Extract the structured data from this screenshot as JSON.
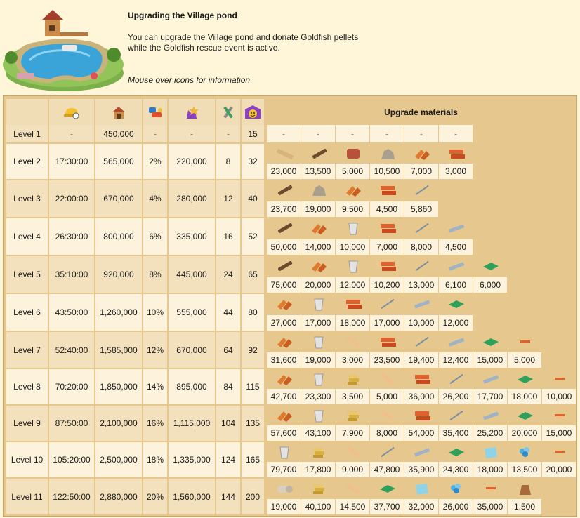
{
  "header": {
    "title": "Upgrading the Village pond",
    "description_line1": "You can upgrade the Village pond and donate Goldfish pellets",
    "description_line2": "while the Goldfish rescue event is active.",
    "hint": "Mouse over icons for information"
  },
  "table": {
    "materials_header": "Upgrade materials",
    "column_icons": [
      "hard-hat-icon",
      "house-icon",
      "percent-icon",
      "star-icon",
      "tools-icon",
      "happiness-icon"
    ],
    "rows": [
      {
        "level": "Level 1",
        "time": "-",
        "coins": "450,000",
        "pct": "-",
        "xp": "-",
        "tools": "-",
        "happy": "15",
        "materials": [
          {
            "icon": "dash",
            "value": "-"
          },
          {
            "icon": "dash",
            "value": "-"
          },
          {
            "icon": "dash",
            "value": "-"
          },
          {
            "icon": "dash",
            "value": "-"
          },
          {
            "icon": "dash",
            "value": "-"
          },
          {
            "icon": "dash",
            "value": "-"
          }
        ]
      },
      {
        "level": "Level 2",
        "time": "17:30:00",
        "coins": "565,000",
        "pct": "2%",
        "xp": "220,000",
        "tools": "8",
        "happy": "32",
        "materials": [
          {
            "icon": "plank",
            "value": "23,000"
          },
          {
            "icon": "log",
            "value": "13,500"
          },
          {
            "icon": "clay",
            "value": "5,000"
          },
          {
            "icon": "stone",
            "value": "10,500"
          },
          {
            "icon": "roof-tile",
            "value": "7,000"
          },
          {
            "icon": "brick",
            "value": "3,000"
          }
        ]
      },
      {
        "level": "Level 3",
        "time": "22:00:00",
        "coins": "670,000",
        "pct": "4%",
        "xp": "280,000",
        "tools": "12",
        "happy": "40",
        "materials": [
          {
            "icon": "log",
            "value": "23,700"
          },
          {
            "icon": "stone",
            "value": "19,000"
          },
          {
            "icon": "roof-tile",
            "value": "9,500"
          },
          {
            "icon": "brick",
            "value": "4,500"
          },
          {
            "icon": "nail",
            "value": "5,860"
          }
        ]
      },
      {
        "level": "Level 4",
        "time": "26:30:00",
        "coins": "800,000",
        "pct": "6%",
        "xp": "335,000",
        "tools": "16",
        "happy": "52",
        "materials": [
          {
            "icon": "log",
            "value": "50,000"
          },
          {
            "icon": "roof-tile",
            "value": "14,000"
          },
          {
            "icon": "mortar",
            "value": "10,000"
          },
          {
            "icon": "brick",
            "value": "7,000"
          },
          {
            "icon": "nail",
            "value": "8,000"
          },
          {
            "icon": "steel-beam",
            "value": "4,500"
          }
        ]
      },
      {
        "level": "Level 5",
        "time": "35:10:00",
        "coins": "920,000",
        "pct": "8%",
        "xp": "445,000",
        "tools": "24",
        "happy": "65",
        "materials": [
          {
            "icon": "log",
            "value": "75,000"
          },
          {
            "icon": "roof-tile",
            "value": "20,000"
          },
          {
            "icon": "mortar",
            "value": "12,000"
          },
          {
            "icon": "brick",
            "value": "10,200"
          },
          {
            "icon": "nail",
            "value": "13,000"
          },
          {
            "icon": "steel-beam",
            "value": "6,100"
          },
          {
            "icon": "glass",
            "value": "6,000"
          }
        ]
      },
      {
        "level": "Level 6",
        "time": "43:50:00",
        "coins": "1,260,000",
        "pct": "10%",
        "xp": "555,000",
        "tools": "44",
        "happy": "80",
        "materials": [
          {
            "icon": "roof-tile",
            "value": "27,000"
          },
          {
            "icon": "mortar",
            "value": "17,000"
          },
          {
            "icon": "brick",
            "value": "18,000"
          },
          {
            "icon": "nail",
            "value": "17,000"
          },
          {
            "icon": "steel-beam",
            "value": "10,000"
          },
          {
            "icon": "glass",
            "value": "12,000"
          }
        ]
      },
      {
        "level": "Level 7",
        "time": "52:40:00",
        "coins": "1,585,000",
        "pct": "12%",
        "xp": "670,000",
        "tools": "64",
        "happy": "92",
        "materials": [
          {
            "icon": "roof-tile",
            "value": "31,600"
          },
          {
            "icon": "mortar",
            "value": "19,000"
          },
          {
            "icon": "board",
            "value": "3,000"
          },
          {
            "icon": "brick",
            "value": "23,500"
          },
          {
            "icon": "nail",
            "value": "19,400"
          },
          {
            "icon": "steel-beam",
            "value": "12,400"
          },
          {
            "icon": "glass",
            "value": "15,000"
          },
          {
            "icon": "box",
            "value": "5,000"
          }
        ]
      },
      {
        "level": "Level 8",
        "time": "70:20:00",
        "coins": "1,850,000",
        "pct": "14%",
        "xp": "895,000",
        "tools": "84",
        "happy": "115",
        "materials": [
          {
            "icon": "roof-tile",
            "value": "42,700"
          },
          {
            "icon": "mortar",
            "value": "23,300"
          },
          {
            "icon": "planks-stack",
            "value": "3,500"
          },
          {
            "icon": "board",
            "value": "5,000"
          },
          {
            "icon": "brick",
            "value": "36,000"
          },
          {
            "icon": "nail",
            "value": "26,200"
          },
          {
            "icon": "steel-beam",
            "value": "17,700"
          },
          {
            "icon": "glass",
            "value": "18,000"
          },
          {
            "icon": "box",
            "value": "10,000"
          }
        ]
      },
      {
        "level": "Level 9",
        "time": "87:50:00",
        "coins": "2,100,000",
        "pct": "16%",
        "xp": "1,115,000",
        "tools": "104",
        "happy": "135",
        "materials": [
          {
            "icon": "roof-tile",
            "value": "57,600"
          },
          {
            "icon": "mortar",
            "value": "43,100"
          },
          {
            "icon": "planks-stack",
            "value": "7,900"
          },
          {
            "icon": "board",
            "value": "8,000"
          },
          {
            "icon": "brick",
            "value": "54,000"
          },
          {
            "icon": "nail",
            "value": "35,400"
          },
          {
            "icon": "steel-beam",
            "value": "25,200"
          },
          {
            "icon": "glass",
            "value": "20,000"
          },
          {
            "icon": "box",
            "value": "15,000"
          }
        ]
      },
      {
        "level": "Level 10",
        "time": "105:20:00",
        "coins": "2,500,000",
        "pct": "18%",
        "xp": "1,335,000",
        "tools": "124",
        "happy": "165",
        "materials": [
          {
            "icon": "mortar",
            "value": "79,700"
          },
          {
            "icon": "planks-stack",
            "value": "17,800"
          },
          {
            "icon": "board",
            "value": "9,000"
          },
          {
            "icon": "nail",
            "value": "47,800"
          },
          {
            "icon": "steel-beam",
            "value": "35,900"
          },
          {
            "icon": "glass",
            "value": "24,300"
          },
          {
            "icon": "glass-pane",
            "value": "18,000"
          },
          {
            "icon": "crystal",
            "value": "13,500"
          },
          {
            "icon": "box",
            "value": "20,000"
          }
        ]
      },
      {
        "level": "Level 11",
        "time": "122:50:00",
        "coins": "2,880,000",
        "pct": "20%",
        "xp": "1,560,000",
        "tools": "144",
        "happy": "200",
        "materials": [
          {
            "icon": "cloth-roll",
            "value": "19,000"
          },
          {
            "icon": "planks-stack",
            "value": "40,100"
          },
          {
            "icon": "board",
            "value": "14,500"
          },
          {
            "icon": "glass",
            "value": "37,700"
          },
          {
            "icon": "glass-pane",
            "value": "32,000"
          },
          {
            "icon": "crystal",
            "value": "26,000"
          },
          {
            "icon": "box",
            "value": "35,000"
          },
          {
            "icon": "sack",
            "value": "1,500"
          }
        ]
      }
    ]
  },
  "colors": {
    "page_bg": "#fff5d8",
    "table_bg": "#e6c88f",
    "row_light": "#fdf2db",
    "row_alt": "#f3e1bd"
  }
}
